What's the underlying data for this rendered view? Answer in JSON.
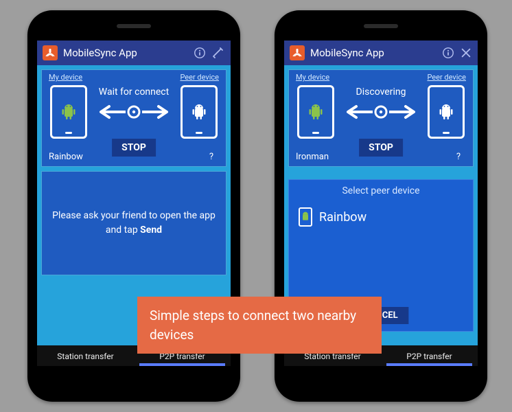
{
  "app_name": "MobileSync App",
  "left": {
    "my_device_label": "My device",
    "peer_device_label": "Peer device",
    "my_device_name": "Rainbow",
    "peer_device_name": "?",
    "status": "Wait for connect",
    "stop_label": "STOP",
    "message_pre": "Please ask your friend to open the app and tap ",
    "message_bold": "Send",
    "tab_station": "Station transfer",
    "tab_p2p": "P2P transfer"
  },
  "right": {
    "my_device_label": "My device",
    "peer_device_label": "Peer device",
    "my_device_name": "Ironman",
    "peer_device_name": "?",
    "status": "Discovering",
    "stop_label": "STOP",
    "overlay_title": "Select peer device",
    "overlay_item": "Rainbow",
    "overlay_cancel": "CANCEL",
    "tab_station": "Station transfer",
    "tab_p2p": "P2P transfer"
  },
  "caption": "Simple steps to connect two nearby devices"
}
